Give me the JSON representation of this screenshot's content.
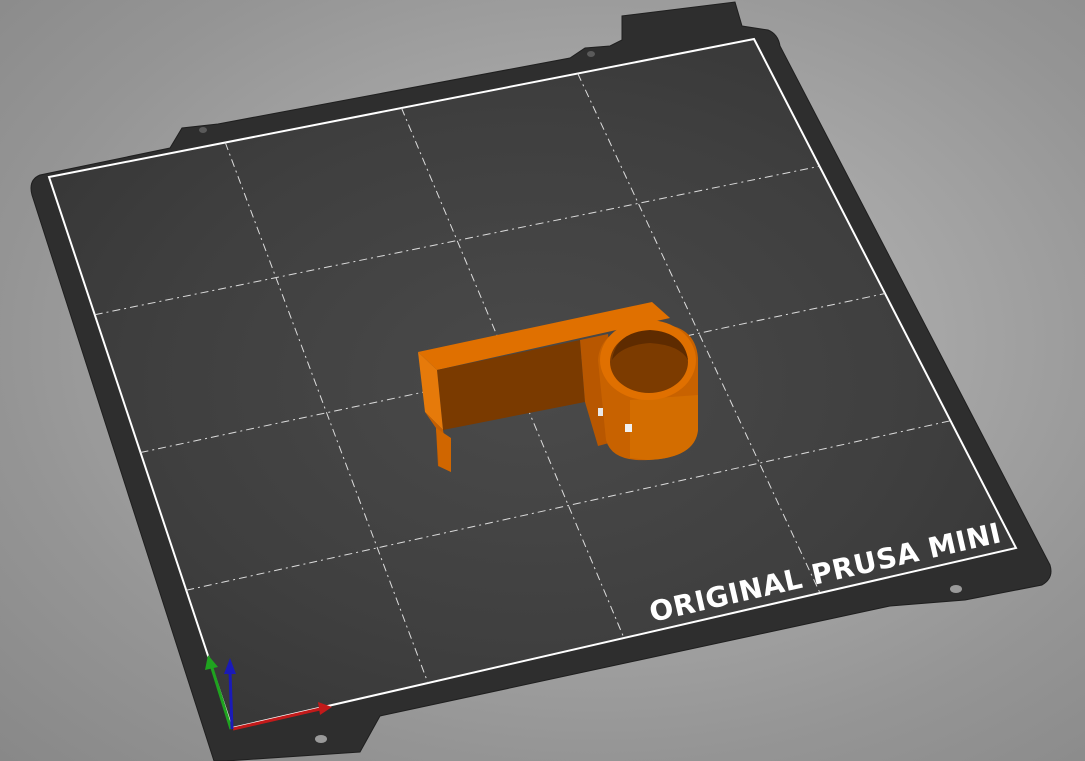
{
  "bed": {
    "label": "ORIGINAL PRUSA MINI",
    "sheet_color": "#2e2e2e",
    "surface_color": "#3c3c3c",
    "grid_color": "#dcdcdc",
    "border_color": "#ffffff"
  },
  "model": {
    "color": "#e07000",
    "shade_color": "#8a3e00"
  },
  "axes": {
    "x_color": "#c21a1a",
    "y_color": "#1fa31f",
    "z_color": "#1a1ab8"
  }
}
